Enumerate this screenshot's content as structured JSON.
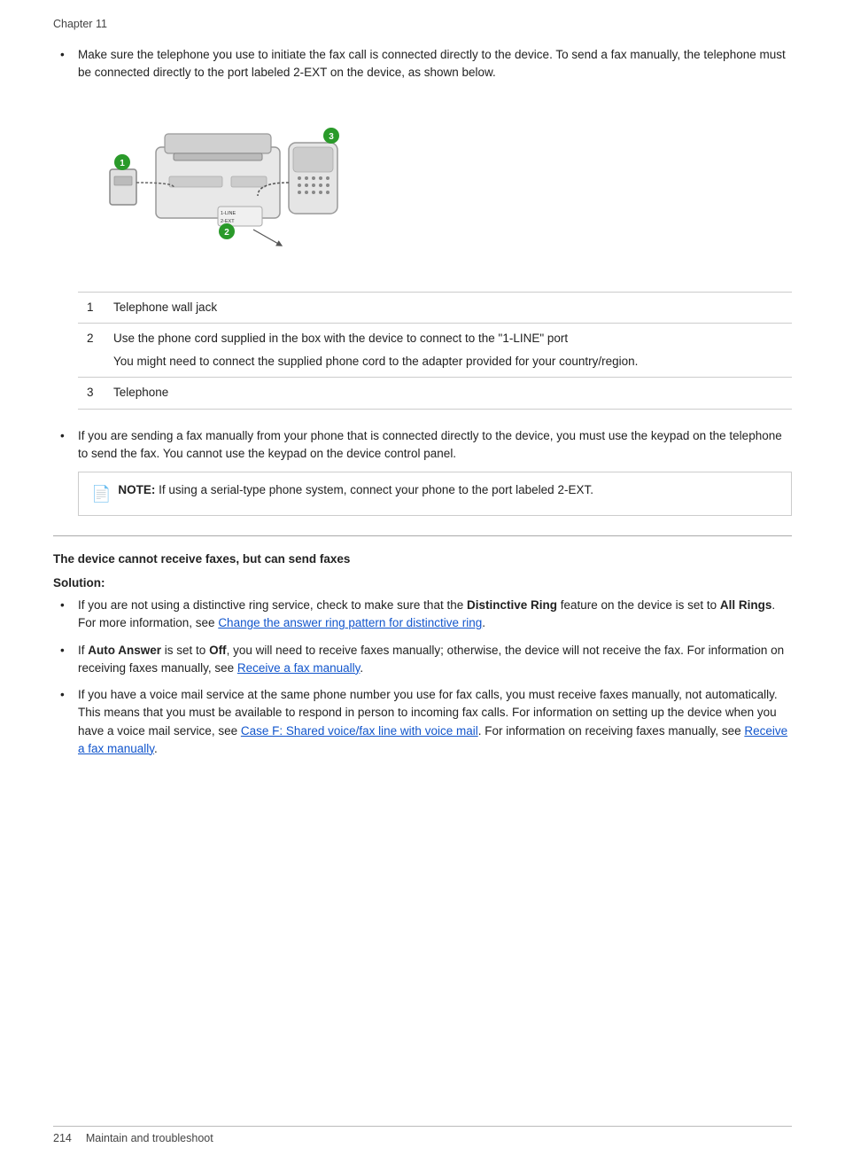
{
  "header": {
    "chapter": "Chapter 11"
  },
  "bullets_top": [
    {
      "id": "bullet1",
      "text": "Make sure the telephone you use to initiate the fax call is connected directly to the device. To send a fax manually, the telephone must be connected directly to the port labeled 2-EXT on the device, as shown below."
    },
    {
      "id": "bullet2",
      "text": "If you are sending a fax manually from your phone that is connected directly to the device, you must use the keypad on the telephone to send the fax. You cannot use the keypad on the device control panel."
    }
  ],
  "parts_table": {
    "rows": [
      {
        "num": "1",
        "description": "Telephone wall jack",
        "extra": ""
      },
      {
        "num": "2",
        "description": "Use the phone cord supplied in the box with the device to connect to the \"1-LINE\" port",
        "extra": "You might need to connect the supplied phone cord to the adapter provided for your country/region."
      },
      {
        "num": "3",
        "description": "Telephone",
        "extra": ""
      }
    ]
  },
  "note": {
    "label": "NOTE:",
    "text": "  If using a serial-type phone system, connect your phone to the port labeled 2-EXT."
  },
  "section": {
    "title": "The device cannot receive faxes, but can send faxes",
    "solution_label": "Solution:",
    "bullets": [
      {
        "id": "s1",
        "parts": [
          {
            "text": "If you are not using a distinctive ring service, check to make sure that the ",
            "bold": false
          },
          {
            "text": "Distinctive Ring",
            "bold": true
          },
          {
            "text": " feature on the device is set to ",
            "bold": false
          },
          {
            "text": "All Rings",
            "bold": true
          },
          {
            "text": ". For more information, see ",
            "bold": false
          },
          {
            "text": "Change the answer ring pattern for distinctive ring",
            "link": true
          },
          {
            "text": ".",
            "bold": false
          }
        ]
      },
      {
        "id": "s2",
        "parts": [
          {
            "text": "If ",
            "bold": false
          },
          {
            "text": "Auto Answer",
            "bold": true
          },
          {
            "text": " is set to ",
            "bold": false
          },
          {
            "text": "Off",
            "bold": true
          },
          {
            "text": ", you will need to receive faxes manually; otherwise, the device will not receive the fax. For information on receiving faxes manually, see ",
            "bold": false
          },
          {
            "text": "Receive a fax manually",
            "link": true
          },
          {
            "text": ".",
            "bold": false
          }
        ]
      },
      {
        "id": "s3",
        "parts": [
          {
            "text": "If you have a voice mail service at the same phone number you use for fax calls, you must receive faxes manually, not automatically. This means that you must be available to respond in person to incoming fax calls. For information on setting up the device when you have a voice mail service, see ",
            "bold": false
          },
          {
            "text": "Case F: Shared voice/fax line with voice mail",
            "link": true
          },
          {
            "text": ". For information on receiving faxes manually, see ",
            "bold": false
          },
          {
            "text": "Receive a fax manually",
            "link": true
          },
          {
            "text": ".",
            "bold": false
          }
        ]
      }
    ]
  },
  "footer": {
    "page": "214",
    "text": "Maintain and troubleshoot"
  }
}
